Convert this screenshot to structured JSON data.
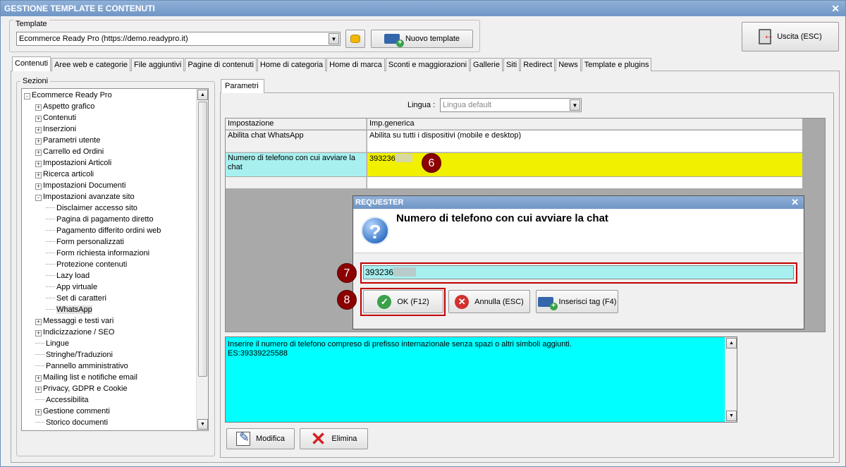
{
  "window": {
    "title": "GESTIONE TEMPLATE E CONTENUTI",
    "close": "✕"
  },
  "template": {
    "legend": "Template",
    "selected": "Ecommerce Ready Pro (https://demo.readypro.it)",
    "new_label": "Nuovo template"
  },
  "exit_label": "Uscita (ESC)",
  "tabs": [
    "Contenuti",
    "Aree web e categorie",
    "File aggiuntivi",
    "Pagine di contenuti",
    "Home di categoria",
    "Home di marca",
    "Sconti e maggiorazioni",
    "Gallerie",
    "Siti",
    "Redirect",
    "News",
    "Template e plugins"
  ],
  "sections": {
    "legend": "Sezioni",
    "items": [
      {
        "label": "Ecommerce Ready Pro",
        "level": 0,
        "toggle": "-"
      },
      {
        "label": "Aspetto grafico",
        "level": 1,
        "toggle": "+"
      },
      {
        "label": "Contenuti",
        "level": 1,
        "toggle": "+"
      },
      {
        "label": "Inserzioni",
        "level": 1,
        "toggle": "+"
      },
      {
        "label": "Parametri utente",
        "level": 1,
        "toggle": "+"
      },
      {
        "label": "Carrello ed Ordini",
        "level": 1,
        "toggle": "+"
      },
      {
        "label": "Impostazioni Articoli",
        "level": 1,
        "toggle": "+"
      },
      {
        "label": "Ricerca articoli",
        "level": 1,
        "toggle": "+"
      },
      {
        "label": "Impostazioni Documenti",
        "level": 1,
        "toggle": "+"
      },
      {
        "label": "Impostazioni avanzate sito",
        "level": 1,
        "toggle": "-"
      },
      {
        "label": "Disclaimer accesso sito",
        "level": 2,
        "toggle": ""
      },
      {
        "label": "Pagina di pagamento diretto",
        "level": 2,
        "toggle": ""
      },
      {
        "label": "Pagamento differito ordini web",
        "level": 2,
        "toggle": ""
      },
      {
        "label": "Form personalizzati",
        "level": 2,
        "toggle": ""
      },
      {
        "label": "Form richiesta informazioni",
        "level": 2,
        "toggle": ""
      },
      {
        "label": "Protezione contenuti",
        "level": 2,
        "toggle": ""
      },
      {
        "label": "Lazy load",
        "level": 2,
        "toggle": ""
      },
      {
        "label": "App virtuale",
        "level": 2,
        "toggle": ""
      },
      {
        "label": "Set di caratteri",
        "level": 2,
        "toggle": ""
      },
      {
        "label": "WhatsApp",
        "level": 2,
        "toggle": "",
        "selected": true
      },
      {
        "label": "Messaggi e testi vari",
        "level": 1,
        "toggle": "+"
      },
      {
        "label": "Indicizzazione / SEO",
        "level": 1,
        "toggle": "+"
      },
      {
        "label": "Lingue",
        "level": 1,
        "toggle": ""
      },
      {
        "label": "Stringhe/Traduzioni",
        "level": 1,
        "toggle": ""
      },
      {
        "label": "Pannello amministrativo",
        "level": 1,
        "toggle": ""
      },
      {
        "label": "Mailing list e notifiche email",
        "level": 1,
        "toggle": "+"
      },
      {
        "label": "Privacy, GDPR e Cookie",
        "level": 1,
        "toggle": "+"
      },
      {
        "label": "Accessibilita",
        "level": 1,
        "toggle": ""
      },
      {
        "label": "Gestione commenti",
        "level": 1,
        "toggle": "+"
      },
      {
        "label": "Storico documenti",
        "level": 1,
        "toggle": ""
      }
    ]
  },
  "params": {
    "tab": "Parametri",
    "lingua_label": "Lingua :",
    "lingua_value": "Lingua default",
    "columns": [
      "Impostazione",
      "Imp.generica"
    ],
    "rows": [
      {
        "setting": "Abilita chat WhatsApp",
        "value": "Abilita su tutti i dispositivi (mobile e desktop)"
      },
      {
        "setting": "Numero di telefono con cui avviare la chat",
        "value": "393236"
      }
    ]
  },
  "markers": {
    "m6": "6",
    "m7": "7",
    "m8": "8"
  },
  "requester": {
    "title": "REQUESTER",
    "close": "✕",
    "question": "Numero di telefono con cui avviare la chat",
    "input_value": "393236",
    "ok_label": "OK (F12)",
    "cancel_label": "Annulla (ESC)",
    "tag_label": "Inserisci tag (F4)"
  },
  "help": {
    "line1": "Inserire il numero di telefono compreso di prefisso internazionale senza spazi o altri simboli aggiunti.",
    "line2": "ES:39339225588"
  },
  "actions": {
    "edit_label": "Modifica",
    "delete_label": "Elimina"
  },
  "colors": {
    "highlight_row": "#f0f000",
    "setting_cell": "#a8f0f0",
    "help_bg": "#00ffff",
    "marker": "#8b0000",
    "red_box": "#c00000"
  }
}
